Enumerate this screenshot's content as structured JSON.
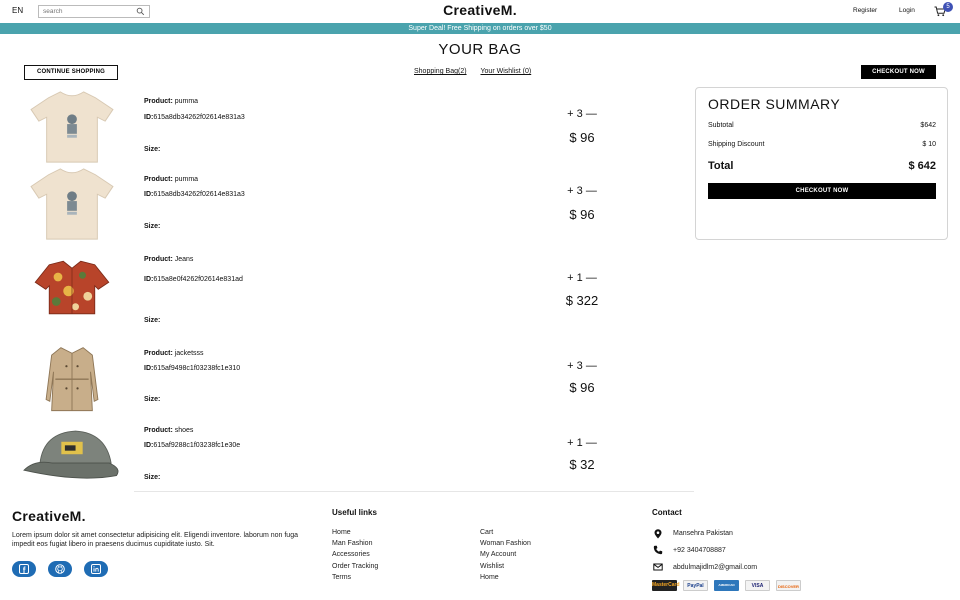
{
  "nav": {
    "lang": "EN",
    "search_placeholder": "search",
    "logo": "CreativeM.",
    "register": "Register",
    "login": "Login",
    "cart_count": "5"
  },
  "announcement": "Super Deal! Free Shipping on orders over $50",
  "page_title": "YOUR BAG",
  "actions": {
    "continue_shopping": "CONTINUE SHOPPING",
    "shopping_bag": "Shopping Bag(2)",
    "wishlist": "Your Wishlist (0)",
    "checkout_now": "CHECKOUT NOW"
  },
  "labels": {
    "product": "Product:",
    "id": "ID:",
    "size": "Size:",
    "plus": "+",
    "minus": "—"
  },
  "products": [
    {
      "name": "pumma",
      "id": "615a8db34262f02614e831a3",
      "size": "",
      "qty": "3",
      "price": "$ 96",
      "image": "tshirt-icon"
    },
    {
      "name": "pumma",
      "id": "615a8db34262f02614e831a3",
      "size": "",
      "qty": "3",
      "price": "$ 96",
      "image": "tshirt-icon"
    },
    {
      "name": "Jeans",
      "id": "615a8e0f4262f02614e831ad",
      "size": "",
      "qty": "1",
      "price": "$ 322",
      "image": "patterned-shirt-icon"
    },
    {
      "name": "jacketsss",
      "id": "615af9498c1f03238fc1e310",
      "size": "",
      "qty": "3",
      "price": "$ 96",
      "image": "trench-coat-icon"
    },
    {
      "name": "shoes",
      "id": "615af9288c1f03238fc1e30e",
      "size": "",
      "qty": "1",
      "price": "$ 32",
      "image": "cap-icon"
    }
  ],
  "summary": {
    "title": "ORDER SUMMARY",
    "subtotal_label": "Subtotal",
    "subtotal_value": "$642",
    "shipping_label": "Shipping Discount",
    "shipping_value": "$ 10",
    "total_label": "Total",
    "total_value": "$ 642",
    "checkout": "CHECKOUT NOW"
  },
  "footer": {
    "logo": "CreativeM.",
    "description": "Lorem ipsum dolor sit amet consectetur adipisicing elit. Eligendi inventore. laborum non fuga impedit eos fugiat libero in praesens ducimus cupiditate iusto. Sit.",
    "useful_links_title": "Useful links",
    "links_col1": [
      "Home",
      "Man Fashion",
      "Accessories",
      "Order Tracking",
      "Terms"
    ],
    "links_col2": [
      "Cart",
      "Woman Fashion",
      "My Account",
      "Wishlist",
      "Home"
    ],
    "contact_title": "Contact",
    "address": "Mansehra Pakistan",
    "phone": "+92 3404708887",
    "email": "abdulmajidlm2@gmail.com",
    "payments": [
      "MasterCard",
      "PayPal",
      "AMERICAN EXPRESS",
      "VISA",
      "DISCOVER"
    ]
  },
  "colors": {
    "announcement_bg": "#4aa3ad",
    "button_bg": "#000000",
    "badge_bg": "#3f51b5",
    "social_bg": "#1f6cb4"
  }
}
